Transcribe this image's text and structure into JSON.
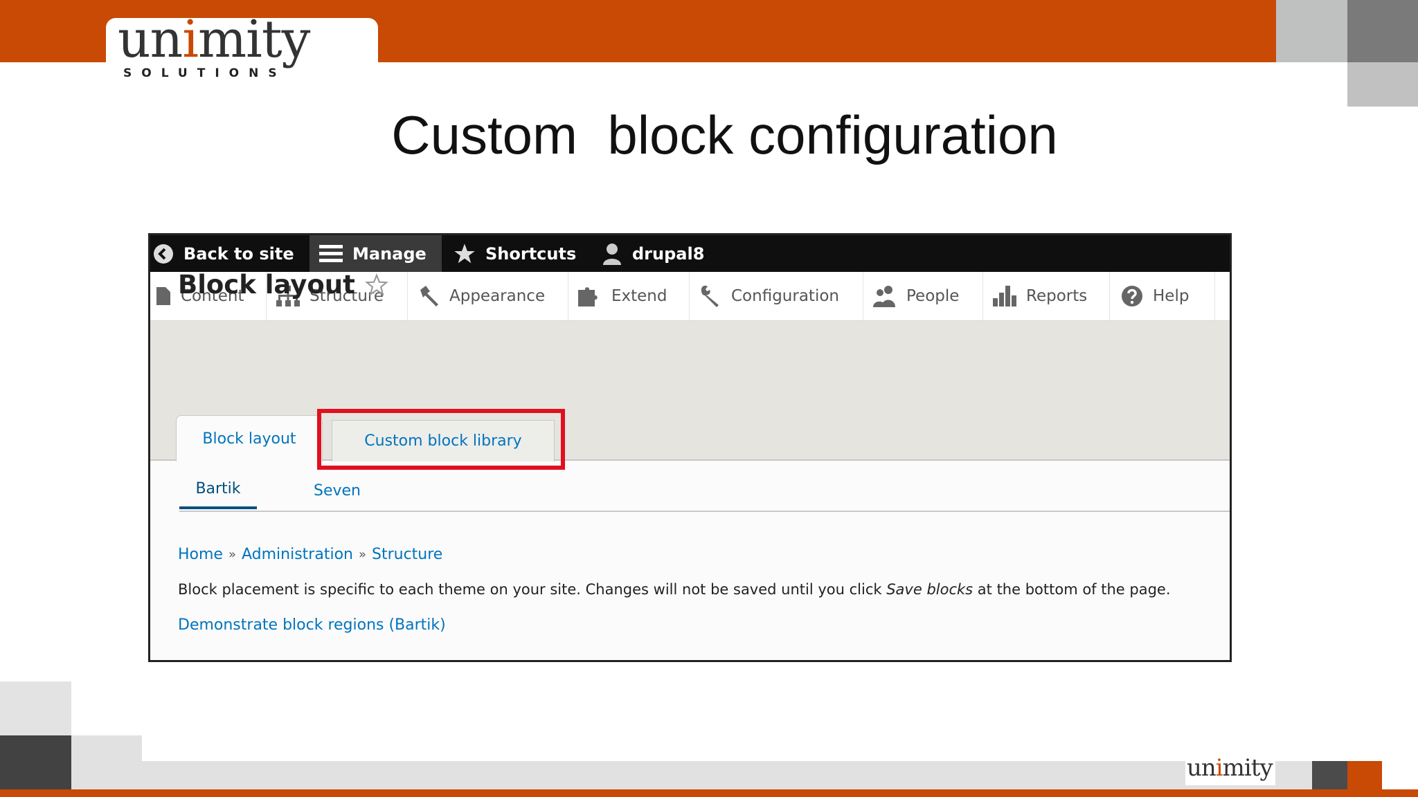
{
  "slide": {
    "title": "Custom  block configuration",
    "logo_word_prefix": "un",
    "logo_word_highlight": "i",
    "logo_word_suffix": "mity",
    "logo_sub": "SOLUTIONS",
    "colors": {
      "accent": "#c84a05",
      "highlight_box": "#e0101f",
      "link": "#0074bd"
    }
  },
  "toolbar": {
    "back": "Back to site",
    "manage": "Manage",
    "shortcuts": "Shortcuts",
    "user": "drupal8"
  },
  "tray": {
    "items": [
      {
        "label": "Content",
        "icon": "file-icon"
      },
      {
        "label": "Structure",
        "icon": "sitemap-icon"
      },
      {
        "label": "Appearance",
        "icon": "paintbrush-icon"
      },
      {
        "label": "Extend",
        "icon": "puzzle-icon"
      },
      {
        "label": "Configuration",
        "icon": "wrench-icon"
      },
      {
        "label": "People",
        "icon": "people-icon"
      },
      {
        "label": "Reports",
        "icon": "bar-chart-icon"
      },
      {
        "label": "Help",
        "icon": "help-icon"
      }
    ]
  },
  "page": {
    "title": "Block layout",
    "tabs": [
      "Block layout",
      "Custom block library"
    ],
    "subtabs": [
      "Bartik",
      "Seven"
    ],
    "breadcrumb": [
      "Home",
      "Administration",
      "Structure"
    ],
    "breadcrumb_sep": "»",
    "description_before": "Block placement is specific to each theme on your site. Changes will not be saved until you click ",
    "description_em": "Save blocks",
    "description_after": " at the bottom of the page.",
    "demo_link": "Demonstrate block regions (Bartik)"
  }
}
